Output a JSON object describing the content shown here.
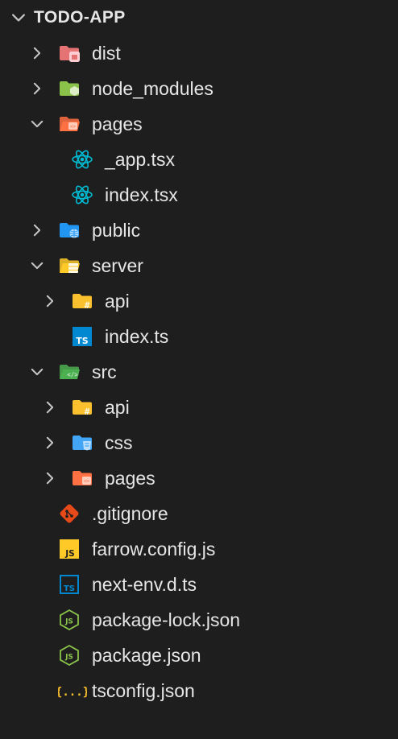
{
  "explorer": {
    "title": "TODO-APP",
    "items": [
      {
        "label": "dist",
        "icon": "folder-dist-icon",
        "depth": 0,
        "twisty": "chevron-right-icon"
      },
      {
        "label": "node_modules",
        "icon": "folder-node-icon",
        "depth": 0,
        "twisty": "chevron-right-icon"
      },
      {
        "label": "pages",
        "icon": "folder-pages-open-icon",
        "depth": 0,
        "twisty": "chevron-down-icon"
      },
      {
        "label": "_app.tsx",
        "icon": "react-icon",
        "depth": 1,
        "twisty": ""
      },
      {
        "label": "index.tsx",
        "icon": "react-icon",
        "depth": 1,
        "twisty": ""
      },
      {
        "label": "public",
        "icon": "folder-public-icon",
        "depth": 0,
        "twisty": "chevron-right-icon"
      },
      {
        "label": "server",
        "icon": "folder-server-open-icon",
        "depth": 0,
        "twisty": "chevron-down-icon"
      },
      {
        "label": "api",
        "icon": "folder-api-icon",
        "depth": 1,
        "twisty": "chevron-right-icon"
      },
      {
        "label": "index.ts",
        "icon": "typescript-icon",
        "depth": 1,
        "twisty": ""
      },
      {
        "label": "src",
        "icon": "folder-src-open-icon",
        "depth": 0,
        "twisty": "chevron-down-icon"
      },
      {
        "label": "api",
        "icon": "folder-api-icon",
        "depth": 1,
        "twisty": "chevron-right-icon"
      },
      {
        "label": "css",
        "icon": "folder-css-icon",
        "depth": 1,
        "twisty": "chevron-right-icon"
      },
      {
        "label": "pages",
        "icon": "folder-pages-icon",
        "depth": 1,
        "twisty": "chevron-right-icon"
      },
      {
        "label": ".gitignore",
        "icon": "git-icon",
        "depth": 0,
        "twisty": ""
      },
      {
        "label": "farrow.config.js",
        "icon": "javascript-icon",
        "depth": 0,
        "twisty": ""
      },
      {
        "label": "next-env.d.ts",
        "icon": "typescript-def-icon",
        "depth": 0,
        "twisty": ""
      },
      {
        "label": "package-lock.json",
        "icon": "nodejs-icon",
        "depth": 0,
        "twisty": ""
      },
      {
        "label": "package.json",
        "icon": "nodejs-icon",
        "depth": 0,
        "twisty": ""
      },
      {
        "label": "tsconfig.json",
        "icon": "json-braces-icon",
        "depth": 0,
        "twisty": ""
      }
    ]
  },
  "icon_text": {
    "js": "JS",
    "ts": "TS",
    "json": "{...}"
  },
  "colors": {
    "background": "#1e1e1e",
    "text": "#e6e6e6",
    "twisty": "#c5c5c5",
    "folder_dist": "#e57373",
    "folder_node": "#8bc34a",
    "folder_pages": "#ff7043",
    "folder_public": "#2196f3",
    "folder_server": "#ffca28",
    "folder_api": "#fbc02d",
    "folder_src": "#4caf50",
    "folder_css": "#42a5f5",
    "react": "#00bcd4",
    "typescript": "#0288d1",
    "git": "#e64a19",
    "javascript": "#ffca28",
    "nodejs": "#8bc34a",
    "json": "#fbc02d"
  }
}
